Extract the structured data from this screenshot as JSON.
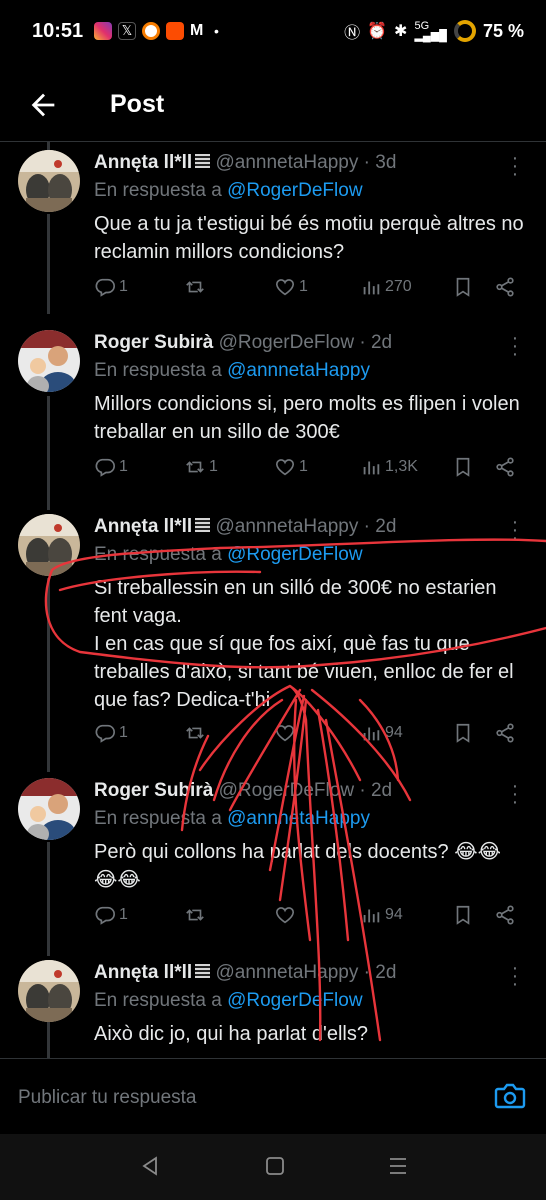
{
  "status_bar": {
    "time": "10:51",
    "battery": "75 %",
    "network": "5G"
  },
  "header": {
    "title": "Post"
  },
  "colors": {
    "accent": "#1d9bf0",
    "background": "#000000",
    "muted": "#71767b",
    "annotation": "#e8353b"
  },
  "tweets": [
    {
      "name": "Annęta ll*ll",
      "handle": "@annnetaHappy",
      "dot": "·",
      "age": "3d",
      "reply_prefix": "En respuesta a",
      "reply_to": "@RogerDeFlow",
      "text": "Que a tu ja t'estigui bé és motiu perquè altres no reclamin millors condicions?",
      "replies": "1",
      "retweets": "",
      "likes": "1",
      "views": "270",
      "avatar": "cat-avatar"
    },
    {
      "name": "Roger Subirà",
      "handle": "@RogerDeFlow",
      "dot": "·",
      "age": "2d",
      "reply_prefix": "En respuesta a",
      "reply_to": "@annnetaHappy",
      "text": "Millors condicions si, pero molts es flipen i volen treballar en un sillo de 300€",
      "replies": "1",
      "retweets": "1",
      "likes": "1",
      "views": "1,3K",
      "avatar": "person-avatar"
    },
    {
      "name": "Annęta ll*ll",
      "handle": "@annnetaHappy",
      "dot": "·",
      "age": "2d",
      "reply_prefix": "En respuesta a",
      "reply_to": "@RogerDeFlow",
      "text": "Si treballessin en un silló de 300€ no estarien fent vaga.\nI en cas que sí que fos així, què fas tu que treballes d'això, si tant bé viuen, enlloc de fer el que fas? Dedica-t'hi",
      "replies": "1",
      "retweets": "",
      "likes": "",
      "views": "94",
      "avatar": "cat-avatar"
    },
    {
      "name": "Roger Subirà",
      "handle": "@RogerDeFlow",
      "dot": "·",
      "age": "2d",
      "reply_prefix": "En respuesta a",
      "reply_to": "@annnetaHappy",
      "text": "Però qui collons ha parlat dels docents? 😂😂😂😂",
      "replies": "1",
      "retweets": "",
      "likes": "",
      "views": "94",
      "avatar": "person-avatar"
    },
    {
      "name": "Annęta ll*ll",
      "handle": "@annnetaHappy",
      "dot": "·",
      "age": "2d",
      "reply_prefix": "En respuesta a",
      "reply_to": "@RogerDeFlow",
      "text": "Això dic jo, qui ha parlat d'ells?",
      "avatar": "cat-avatar"
    }
  ],
  "reply_bar": {
    "placeholder": "Publicar tu respuesta"
  }
}
